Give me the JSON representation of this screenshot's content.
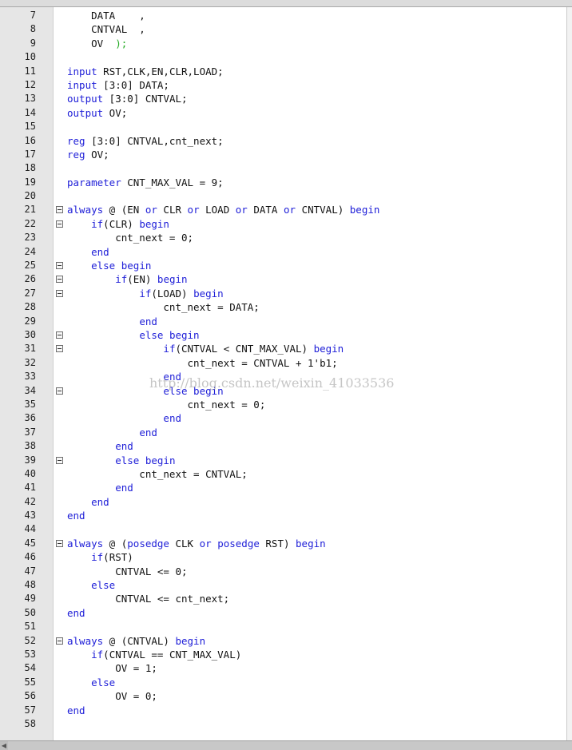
{
  "editor": {
    "lines": [
      {
        "n": "7",
        "fold": false,
        "tokens": [
          {
            "t": "    DATA    ,"
          }
        ]
      },
      {
        "n": "8",
        "fold": false,
        "tokens": [
          {
            "t": "    CNTVAL  ,"
          }
        ]
      },
      {
        "n": "9",
        "fold": false,
        "tokens": [
          {
            "t": "    OV  "
          },
          {
            "t": ");",
            "c": "paren"
          }
        ]
      },
      {
        "n": "10",
        "fold": false,
        "tokens": []
      },
      {
        "n": "11",
        "fold": false,
        "tokens": [
          {
            "t": "input",
            "c": "kw"
          },
          {
            "t": " RST,CLK,EN,CLR,LOAD;"
          }
        ]
      },
      {
        "n": "12",
        "fold": false,
        "tokens": [
          {
            "t": "input",
            "c": "kw"
          },
          {
            "t": " [3:0] DATA;"
          }
        ]
      },
      {
        "n": "13",
        "fold": false,
        "tokens": [
          {
            "t": "output",
            "c": "kw"
          },
          {
            "t": " [3:0] CNTVAL;"
          }
        ]
      },
      {
        "n": "14",
        "fold": false,
        "tokens": [
          {
            "t": "output",
            "c": "kw"
          },
          {
            "t": " OV;"
          }
        ]
      },
      {
        "n": "15",
        "fold": false,
        "tokens": []
      },
      {
        "n": "16",
        "fold": false,
        "tokens": [
          {
            "t": "reg",
            "c": "kw"
          },
          {
            "t": " [3:0] CNTVAL,cnt_next;"
          }
        ]
      },
      {
        "n": "17",
        "fold": false,
        "tokens": [
          {
            "t": "reg",
            "c": "kw"
          },
          {
            "t": " OV;"
          }
        ]
      },
      {
        "n": "18",
        "fold": false,
        "tokens": []
      },
      {
        "n": "19",
        "fold": false,
        "tokens": [
          {
            "t": "parameter",
            "c": "kw"
          },
          {
            "t": " CNT_MAX_VAL = 9;"
          }
        ]
      },
      {
        "n": "20",
        "fold": false,
        "tokens": []
      },
      {
        "n": "21",
        "fold": true,
        "tokens": [
          {
            "t": "always",
            "c": "kw"
          },
          {
            "t": " @ (EN "
          },
          {
            "t": "or",
            "c": "kw"
          },
          {
            "t": " CLR "
          },
          {
            "t": "or",
            "c": "kw"
          },
          {
            "t": " LOAD "
          },
          {
            "t": "or",
            "c": "kw"
          },
          {
            "t": " DATA "
          },
          {
            "t": "or",
            "c": "kw"
          },
          {
            "t": " CNTVAL) "
          },
          {
            "t": "begin",
            "c": "kw"
          }
        ]
      },
      {
        "n": "22",
        "fold": true,
        "tokens": [
          {
            "t": "    "
          },
          {
            "t": "if",
            "c": "kw"
          },
          {
            "t": "(CLR) "
          },
          {
            "t": "begin",
            "c": "kw"
          }
        ]
      },
      {
        "n": "23",
        "fold": false,
        "tokens": [
          {
            "t": "        cnt_next = 0;"
          }
        ]
      },
      {
        "n": "24",
        "fold": false,
        "tokens": [
          {
            "t": "    "
          },
          {
            "t": "end",
            "c": "kw"
          }
        ]
      },
      {
        "n": "25",
        "fold": true,
        "tokens": [
          {
            "t": "    "
          },
          {
            "t": "else begin",
            "c": "kw"
          }
        ]
      },
      {
        "n": "26",
        "fold": true,
        "tokens": [
          {
            "t": "        "
          },
          {
            "t": "if",
            "c": "kw"
          },
          {
            "t": "(EN) "
          },
          {
            "t": "begin",
            "c": "kw"
          }
        ]
      },
      {
        "n": "27",
        "fold": true,
        "tokens": [
          {
            "t": "            "
          },
          {
            "t": "if",
            "c": "kw"
          },
          {
            "t": "(LOAD) "
          },
          {
            "t": "begin",
            "c": "kw"
          }
        ]
      },
      {
        "n": "28",
        "fold": false,
        "tokens": [
          {
            "t": "                cnt_next = DATA;"
          }
        ]
      },
      {
        "n": "29",
        "fold": false,
        "tokens": [
          {
            "t": "            "
          },
          {
            "t": "end",
            "c": "kw"
          }
        ]
      },
      {
        "n": "30",
        "fold": true,
        "tokens": [
          {
            "t": "            "
          },
          {
            "t": "else begin",
            "c": "kw"
          }
        ]
      },
      {
        "n": "31",
        "fold": true,
        "tokens": [
          {
            "t": "                "
          },
          {
            "t": "if",
            "c": "kw"
          },
          {
            "t": "(CNTVAL < CNT_MAX_VAL) "
          },
          {
            "t": "begin",
            "c": "kw"
          }
        ]
      },
      {
        "n": "32",
        "fold": false,
        "tokens": [
          {
            "t": "                    cnt_next = CNTVAL + 1'b1;"
          }
        ]
      },
      {
        "n": "33",
        "fold": false,
        "tokens": [
          {
            "t": "                "
          },
          {
            "t": "end",
            "c": "kw"
          }
        ]
      },
      {
        "n": "34",
        "fold": true,
        "tokens": [
          {
            "t": "                "
          },
          {
            "t": "else begin",
            "c": "kw"
          }
        ]
      },
      {
        "n": "35",
        "fold": false,
        "tokens": [
          {
            "t": "                    cnt_next = 0;"
          }
        ]
      },
      {
        "n": "36",
        "fold": false,
        "tokens": [
          {
            "t": "                "
          },
          {
            "t": "end",
            "c": "kw"
          }
        ]
      },
      {
        "n": "37",
        "fold": false,
        "tokens": [
          {
            "t": "            "
          },
          {
            "t": "end",
            "c": "kw"
          }
        ]
      },
      {
        "n": "38",
        "fold": false,
        "tokens": [
          {
            "t": "        "
          },
          {
            "t": "end",
            "c": "kw"
          }
        ]
      },
      {
        "n": "39",
        "fold": true,
        "tokens": [
          {
            "t": "        "
          },
          {
            "t": "else begin",
            "c": "kw"
          }
        ]
      },
      {
        "n": "40",
        "fold": false,
        "tokens": [
          {
            "t": "            cnt_next = CNTVAL;"
          }
        ]
      },
      {
        "n": "41",
        "fold": false,
        "tokens": [
          {
            "t": "        "
          },
          {
            "t": "end",
            "c": "kw"
          }
        ]
      },
      {
        "n": "42",
        "fold": false,
        "tokens": [
          {
            "t": "    "
          },
          {
            "t": "end",
            "c": "kw"
          }
        ]
      },
      {
        "n": "43",
        "fold": false,
        "tokens": [
          {
            "t": "end",
            "c": "kw"
          }
        ]
      },
      {
        "n": "44",
        "fold": false,
        "tokens": []
      },
      {
        "n": "45",
        "fold": true,
        "tokens": [
          {
            "t": "always",
            "c": "kw"
          },
          {
            "t": " @ ("
          },
          {
            "t": "posedge",
            "c": "kw"
          },
          {
            "t": " CLK "
          },
          {
            "t": "or",
            "c": "kw"
          },
          {
            "t": " "
          },
          {
            "t": "posedge",
            "c": "kw"
          },
          {
            "t": " RST) "
          },
          {
            "t": "begin",
            "c": "kw"
          }
        ]
      },
      {
        "n": "46",
        "fold": false,
        "tokens": [
          {
            "t": "    "
          },
          {
            "t": "if",
            "c": "kw"
          },
          {
            "t": "(RST)"
          }
        ]
      },
      {
        "n": "47",
        "fold": false,
        "tokens": [
          {
            "t": "        CNTVAL <= 0;"
          }
        ]
      },
      {
        "n": "48",
        "fold": false,
        "tokens": [
          {
            "t": "    "
          },
          {
            "t": "else",
            "c": "kw"
          }
        ]
      },
      {
        "n": "49",
        "fold": false,
        "tokens": [
          {
            "t": "        CNTVAL <= cnt_next;"
          }
        ]
      },
      {
        "n": "50",
        "fold": false,
        "tokens": [
          {
            "t": "end",
            "c": "kw"
          }
        ]
      },
      {
        "n": "51",
        "fold": false,
        "tokens": []
      },
      {
        "n": "52",
        "fold": true,
        "tokens": [
          {
            "t": "always",
            "c": "kw"
          },
          {
            "t": " @ (CNTVAL) "
          },
          {
            "t": "begin",
            "c": "kw"
          }
        ]
      },
      {
        "n": "53",
        "fold": false,
        "tokens": [
          {
            "t": "    "
          },
          {
            "t": "if",
            "c": "kw"
          },
          {
            "t": "(CNTVAL == CNT_MAX_VAL)"
          }
        ]
      },
      {
        "n": "54",
        "fold": false,
        "tokens": [
          {
            "t": "        OV = 1;"
          }
        ]
      },
      {
        "n": "55",
        "fold": false,
        "tokens": [
          {
            "t": "    "
          },
          {
            "t": "else",
            "c": "kw"
          }
        ]
      },
      {
        "n": "56",
        "fold": false,
        "tokens": [
          {
            "t": "        OV = 0;"
          }
        ]
      },
      {
        "n": "57",
        "fold": false,
        "tokens": [
          {
            "t": "end",
            "c": "kw"
          }
        ]
      },
      {
        "n": "58",
        "fold": false,
        "tokens": []
      }
    ]
  },
  "watermark": "http://blog.csdn.net/weixin_41033536",
  "colors": {
    "keyword": "#2020d8",
    "text": "#111111",
    "paren": "#22aa22",
    "gutter": "#e6e6e6"
  }
}
